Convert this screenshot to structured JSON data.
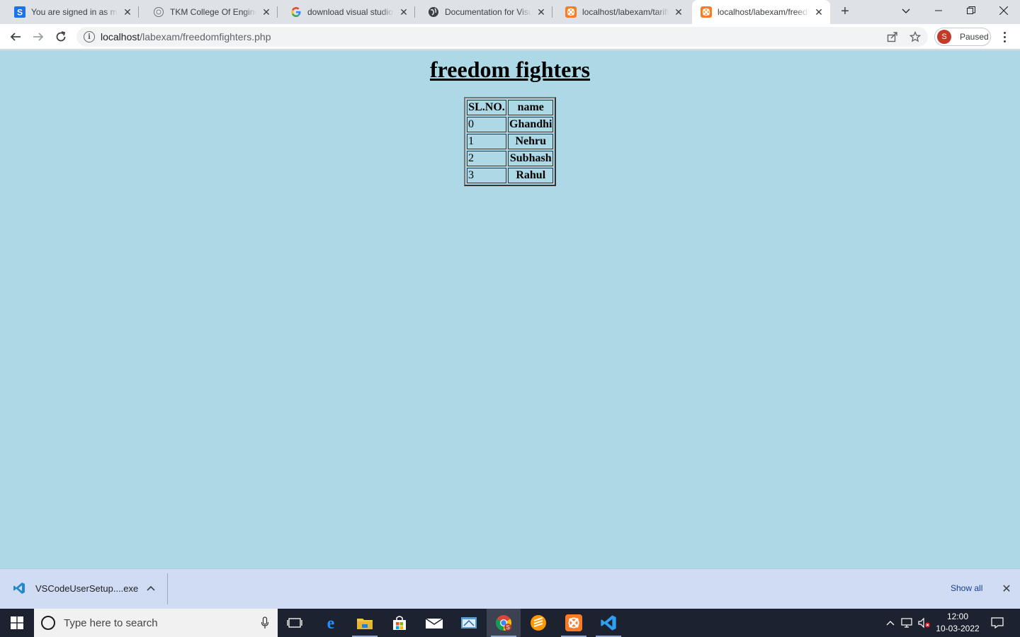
{
  "browser": {
    "tabs": [
      {
        "title": "You are signed in as mca",
        "favicon": "s-letter-icon",
        "active": false
      },
      {
        "title": "TKM College Of Engineering",
        "favicon": "college-logo-icon",
        "active": false
      },
      {
        "title": "download visual studio code",
        "favicon": "google-g-icon",
        "active": false
      },
      {
        "title": "Documentation for Visual Studio",
        "favicon": "globe-icon",
        "active": false
      },
      {
        "title": "localhost/labexam/tariff.php",
        "favicon": "xampp-icon",
        "active": false
      },
      {
        "title": "localhost/labexam/freedomfighters.php",
        "favicon": "xampp-icon",
        "active": true
      }
    ],
    "address": {
      "host": "localhost",
      "path": "/labexam/freedomfighters.php"
    },
    "profile": {
      "initial": "S",
      "status": "Paused"
    }
  },
  "page": {
    "heading": "freedom fighters",
    "table": {
      "headers": [
        "SL.NO.",
        "name"
      ],
      "rows": [
        {
          "sl": "0",
          "name": "Ghandhi"
        },
        {
          "sl": "1",
          "name": "Nehru"
        },
        {
          "sl": "2",
          "name": "Subhash"
        },
        {
          "sl": "3",
          "name": "Rahul"
        }
      ]
    },
    "background_color": "#add8e6"
  },
  "downloads": {
    "file": "VSCodeUserSetup....exe",
    "show_all": "Show all"
  },
  "taskbar": {
    "search_placeholder": "Type here to search",
    "time": "12:00",
    "date": "10-03-2022"
  }
}
